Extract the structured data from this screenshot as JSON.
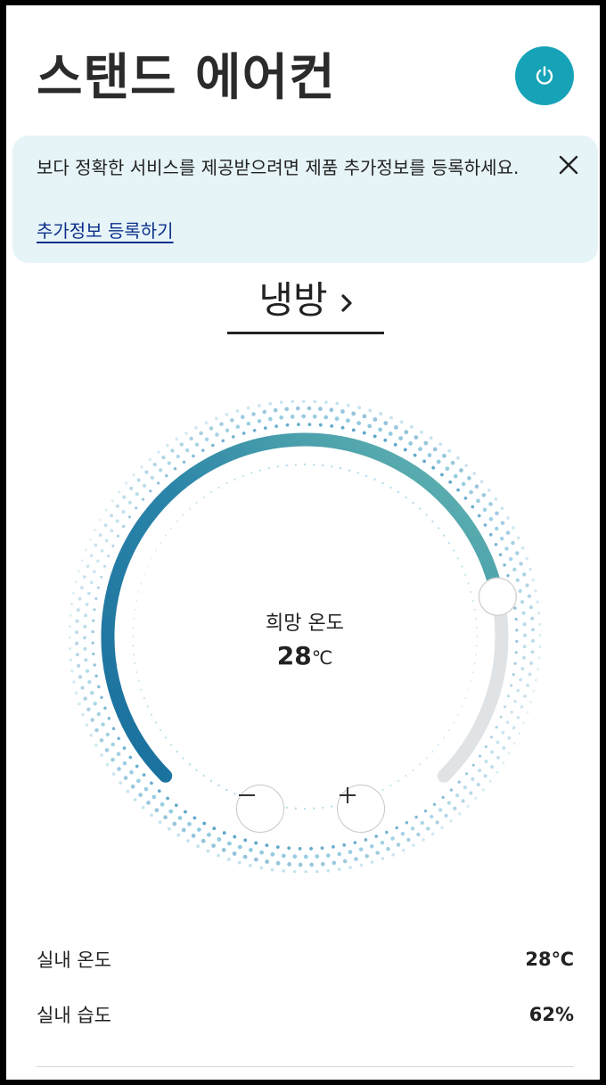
{
  "header": {
    "title": "스탠드 에어컨",
    "power_icon": "power-icon"
  },
  "banner": {
    "message": "보다 정확한 서비스를 제공받으려면 제품 추가정보를 등록하세요.",
    "link": "추가정보 등록하기",
    "close_icon": "close-icon"
  },
  "mode": {
    "label": "냉방",
    "icon": "chevron-right-icon"
  },
  "dial": {
    "caption": "희망 온도",
    "value": "28",
    "unit": "℃",
    "level": 0.79,
    "gradient": [
      "#1a6f9d",
      "#2a84a8",
      "#6cbcb0"
    ],
    "track_color": "#dfe3e6",
    "minus_icon": "minus-icon",
    "plus_icon": "plus-icon"
  },
  "stats": [
    {
      "label": "실내 온도",
      "value": "28℃"
    },
    {
      "label": "실내 습도",
      "value": "62%"
    }
  ],
  "colors": {
    "accent": "#16a3b8",
    "banner_bg": "#e6f4f8",
    "link": "#0b2f8a"
  }
}
